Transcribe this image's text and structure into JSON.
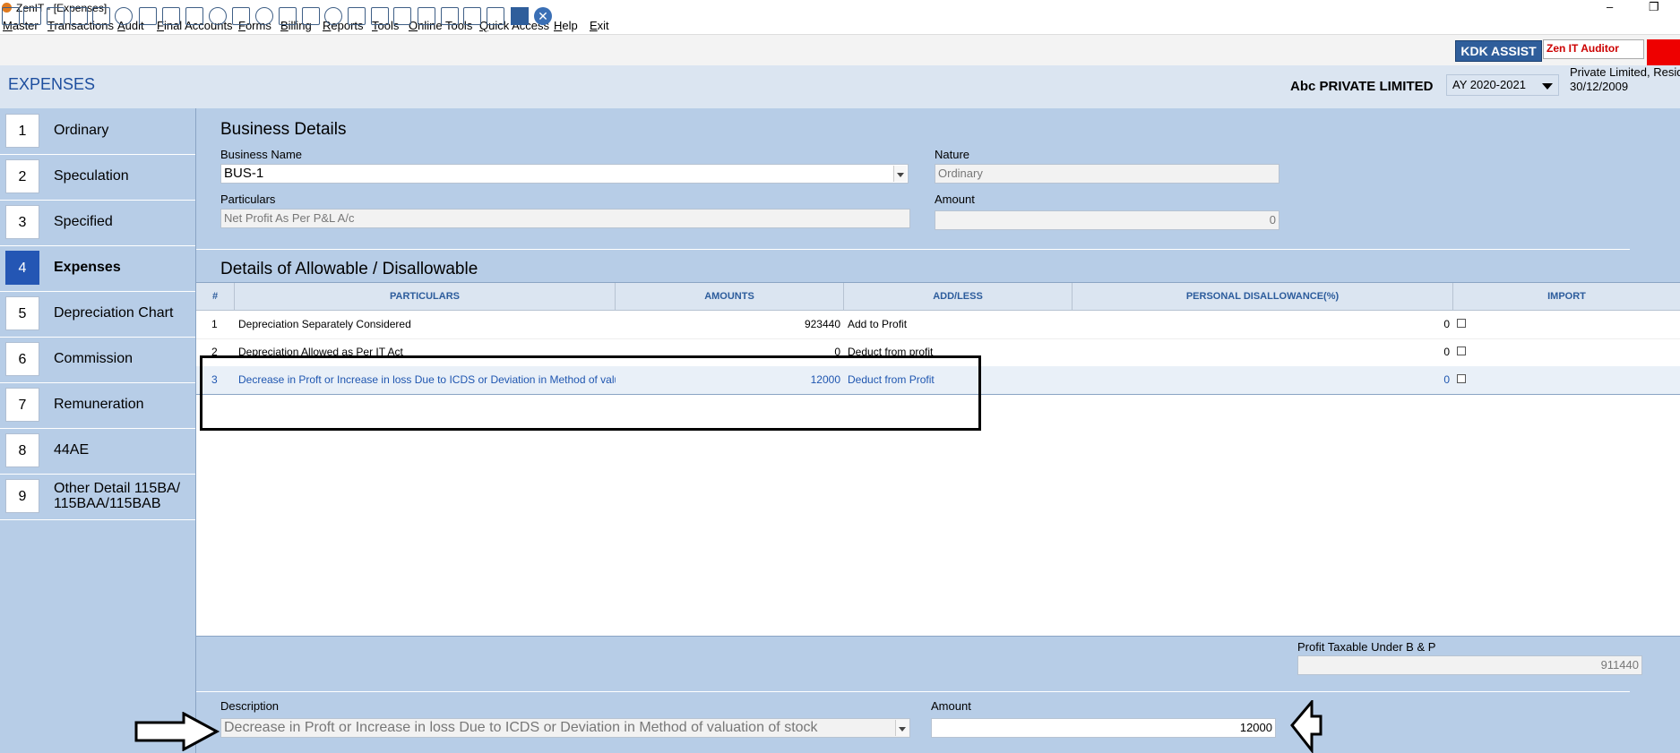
{
  "window": {
    "title": "ZenIT - [Expenses]",
    "minimize": "–",
    "restore": "❐"
  },
  "menu": [
    "Master",
    "Transactions",
    "Audit",
    "Final Accounts",
    "Forms",
    "Billing",
    "Reports",
    "Tools",
    "Online Tools",
    "Quick Access",
    "Help",
    "Exit"
  ],
  "toolbar": {
    "icons": [
      "app-icon",
      "home-icon",
      "building-icon",
      "bar-chart-icon",
      "gift-icon",
      "group-icon",
      "hammer-icon",
      "filter-icon",
      "tax-icon",
      "refresh-icon",
      "calculator-icon",
      "pie-chart-icon",
      "pay-icon",
      "book-icon",
      "info-icon",
      "report-icon",
      "person-report-icon",
      "calendar-icon",
      "settings-icon",
      "balance-sheet-icon",
      "3cd-icon",
      "form-icon",
      "fac-icon",
      "close-circle-icon"
    ],
    "kdk_label": "KDK ASSIST",
    "zen_label": "Zen IT Auditor",
    "accent": "#ee0000"
  },
  "header": {
    "page_title": "EXPENSES",
    "company": "Abc PRIVATE LIMITED",
    "ay": "AY 2020-2021",
    "company_type": "Private Limited, Resid",
    "date": "30/12/2009"
  },
  "sidebar": {
    "items": [
      {
        "num": "1",
        "label": "Ordinary",
        "active": false
      },
      {
        "num": "2",
        "label": "Speculation",
        "active": false
      },
      {
        "num": "3",
        "label": "Specified",
        "active": false
      },
      {
        "num": "4",
        "label": "Expenses",
        "active": true
      },
      {
        "num": "5",
        "label": "Depreciation Chart",
        "active": false
      },
      {
        "num": "6",
        "label": "Commission",
        "active": false
      },
      {
        "num": "7",
        "label": "Remuneration",
        "active": false
      },
      {
        "num": "8",
        "label": "44AE",
        "active": false
      },
      {
        "num": "9",
        "label_line1": "Other Detail 115BA/",
        "label_line2": "115BAA/115BAB",
        "active": false
      }
    ]
  },
  "business": {
    "section_title": "Business Details",
    "name_label": "Business Name",
    "name_value": "BUS-1",
    "nature_label": "Nature",
    "nature_value": "Ordinary",
    "particulars_label": "Particulars",
    "particulars_value": "Net Profit As Per P&L A/c",
    "amount_label": "Amount",
    "amount_value": "0"
  },
  "details": {
    "section_title": "Details of Allowable / Disallowable",
    "columns": [
      "#",
      "PARTICULARS",
      "AMOUNTS",
      "ADD/LESS",
      "PERSONAL DISALLOWANCE(%)",
      "IMPORT"
    ],
    "rows": [
      {
        "num": "1",
        "particulars": "Depreciation Separately Considered",
        "amount": "923440",
        "addless": "Add to Profit",
        "personal": "0"
      },
      {
        "num": "2",
        "particulars": "Depreciation Allowed as Per IT Act",
        "amount": "0",
        "addless": "Deduct from profit",
        "personal": "0"
      },
      {
        "num": "3",
        "particulars": "Decrease in Proft or Increase in loss Due to ICDS or Deviation in Method of valuation of stock",
        "amount": "12000",
        "addless": "Deduct from Profit",
        "personal": "0"
      }
    ]
  },
  "footer": {
    "profit_label": "Profit Taxable Under B & P",
    "profit_value": "911440",
    "description_label": "Description",
    "description_value": "Decrease in Proft or Increase in loss Due to ICDS or Deviation in Method of valuation of stock",
    "amount_label": "Amount",
    "amount_value": "12000"
  }
}
